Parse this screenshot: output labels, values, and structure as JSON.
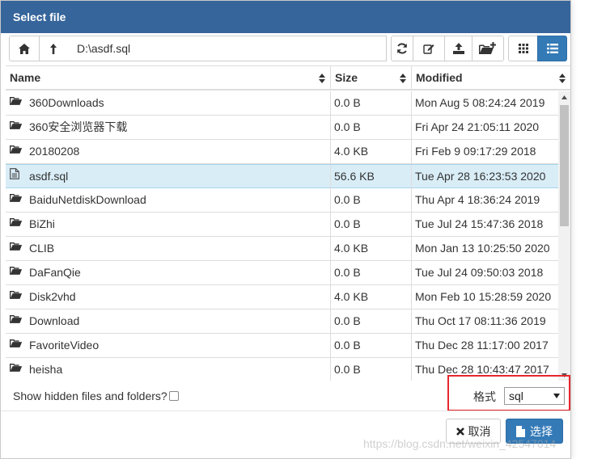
{
  "window": {
    "title": "Select file"
  },
  "toolbar": {
    "path_value": "D:\\asdf.sql",
    "home_icon": "home-icon",
    "up_icon": "arrow-up-icon",
    "refresh_icon": "refresh-icon",
    "edit_icon": "edit-icon",
    "upload_icon": "upload-icon",
    "new_folder_icon": "new-folder-icon",
    "grid_view_icon": "grid-view-icon",
    "list_view_icon": "list-view-icon"
  },
  "table": {
    "columns": [
      "Name",
      "Size",
      "Modified"
    ],
    "rows": [
      {
        "type": "folder",
        "name": "360Downloads",
        "size": "0.0 B",
        "modified": "Mon Aug 5 08:24:24 2019"
      },
      {
        "type": "folder",
        "name": "360安全浏览器下载",
        "size": "0.0 B",
        "modified": "Fri Apr 24 21:05:11 2020"
      },
      {
        "type": "folder",
        "name": "20180208",
        "size": "4.0 KB",
        "modified": "Fri Feb 9 09:17:29 2018"
      },
      {
        "type": "file",
        "name": "asdf.sql",
        "size": "56.6 KB",
        "modified": "Tue Apr 28 16:23:53 2020",
        "selected": true
      },
      {
        "type": "folder",
        "name": "BaiduNetdiskDownload",
        "size": "0.0 B",
        "modified": "Thu Apr 4 18:36:24 2019"
      },
      {
        "type": "folder",
        "name": "BiZhi",
        "size": "0.0 B",
        "modified": "Tue Jul 24 15:47:36 2018"
      },
      {
        "type": "folder",
        "name": "CLIB",
        "size": "4.0 KB",
        "modified": "Mon Jan 13 10:25:50 2020"
      },
      {
        "type": "folder",
        "name": "DaFanQie",
        "size": "0.0 B",
        "modified": "Tue Jul 24 09:50:03 2018"
      },
      {
        "type": "folder",
        "name": "Disk2vhd",
        "size": "4.0 KB",
        "modified": "Mon Feb 10 15:28:59 2020"
      },
      {
        "type": "folder",
        "name": "Download",
        "size": "0.0 B",
        "modified": "Thu Oct 17 08:11:36 2019"
      },
      {
        "type": "folder",
        "name": "FavoriteVideo",
        "size": "0.0 B",
        "modified": "Thu Dec 28 11:17:00 2017"
      },
      {
        "type": "folder",
        "name": "heisha",
        "size": "0.0 B",
        "modified": "Thu Dec 28 10:43:47 2017"
      }
    ]
  },
  "footer": {
    "hidden_label": "Show hidden files and folders?",
    "format_label": "格式",
    "format_value": "sql",
    "cancel_label": "取消",
    "select_label": "选择",
    "watermark": "https://blog.csdn.net/weixin_42547014"
  },
  "colors": {
    "titlebar": "#36659b",
    "selected_row": "#d9edf7",
    "primary_button": "#337ab7",
    "highlight_box": "#e6262c"
  }
}
